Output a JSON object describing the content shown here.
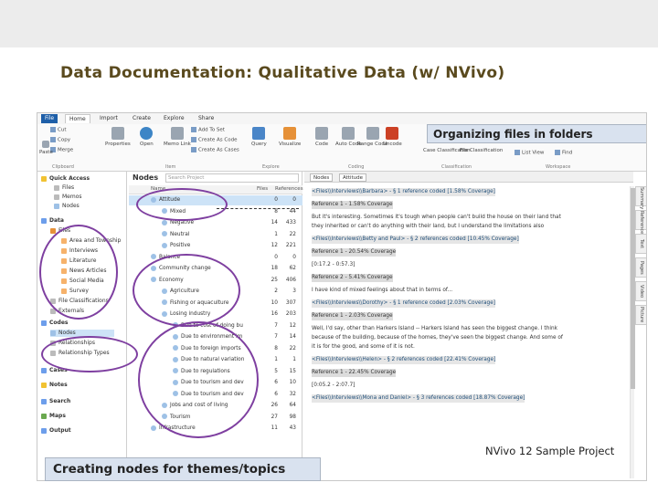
{
  "slide": {
    "title": "Data Documentation: Qualitative Data (w/ NVivo)",
    "callout_folders": "Organizing files in folders",
    "callout_nodes": "Creating nodes for themes/topics",
    "sample_project": "NVivo 12 Sample Project"
  },
  "ribbon": {
    "tabs": [
      "File",
      "Home",
      "Import",
      "Create",
      "Explore",
      "Share"
    ],
    "buttons": [
      "Cut",
      "Copy",
      "Merge",
      "Paste",
      "Properties",
      "Open",
      "Memo Link",
      "Add To Set",
      "Create As Code",
      "Create As Cases",
      "Query",
      "Visualize",
      "Code",
      "Auto Code",
      "Range Code",
      "Uncode",
      "Case Classification",
      "File Classification",
      "List View",
      "Find"
    ],
    "groups": [
      "Clipboard",
      "Item",
      "Explore",
      "Coding",
      "Classification",
      "Workspace"
    ]
  },
  "nav": {
    "items": [
      "Quick Access",
      "Files",
      "Memos",
      "Nodes",
      "Data",
      "Files",
      "Area and Township",
      "Interviews",
      "Literature",
      "News Articles",
      "Social Media",
      "Survey",
      "File Classifications",
      "Externals",
      "Codes",
      "Nodes",
      "Relationships",
      "Relationship Types",
      "Cases",
      "Notes",
      "Search",
      "Maps",
      "Output"
    ]
  },
  "nodes_pane": {
    "title": "Nodes",
    "search_placeholder": "Search Project",
    "col_name": "Name",
    "col_files": "Files",
    "col_refs": "References",
    "rows": [
      {
        "name": "Attitude",
        "files": "0",
        "refs": "0"
      },
      {
        "name": "Mixed",
        "files": "8",
        "refs": "44"
      },
      {
        "name": "Negative",
        "files": "14",
        "refs": "433"
      },
      {
        "name": "Neutral",
        "files": "1",
        "refs": "22"
      },
      {
        "name": "Positive",
        "files": "12",
        "refs": "221"
      },
      {
        "name": "Balance",
        "files": "0",
        "refs": "0"
      },
      {
        "name": "Community change",
        "files": "18",
        "refs": "62"
      },
      {
        "name": "Economy",
        "files": "25",
        "refs": "406"
      },
      {
        "name": "Agriculture",
        "files": "2",
        "refs": "3"
      },
      {
        "name": "Fishing or aquaculture",
        "files": "10",
        "refs": "307"
      },
      {
        "name": "Losing industry",
        "files": "16",
        "refs": "203"
      },
      {
        "name": "Due to cost of doing bu",
        "files": "7",
        "refs": "12"
      },
      {
        "name": "Due to environment im",
        "files": "7",
        "refs": "14"
      },
      {
        "name": "Due to foreign imports",
        "files": "8",
        "refs": "22"
      },
      {
        "name": "Due to natural variation",
        "files": "1",
        "refs": "1"
      },
      {
        "name": "Due to regulations",
        "files": "5",
        "refs": "15"
      },
      {
        "name": "Due to tourism and dev",
        "files": "6",
        "refs": "10"
      },
      {
        "name": "Due to tourism and dev",
        "files": "6",
        "refs": "32"
      },
      {
        "name": "Jobs and cost of living",
        "files": "26",
        "refs": "64"
      },
      {
        "name": "Tourism",
        "files": "27",
        "refs": "98"
      },
      {
        "name": "Infrastructure",
        "files": "11",
        "refs": "43"
      }
    ]
  },
  "ref_pane": {
    "tabs": [
      "Nodes",
      "Attitude"
    ],
    "lines": [
      "<Files\\\\Interviews\\\\Barbara> - § 1 reference coded [1.58% Coverage]",
      "Reference 1 - 1.58% Coverage",
      "But it's interesting. Sometimes it's tough when people can't build the house on their land that",
      "they inherited or can't do anything with their land, but I understand the limitations also",
      "<Files\\\\Interviews\\\\Betty and Paul> - § 2 references coded [10.45% Coverage]",
      "Reference 1 - 20.54% Coverage",
      "[0:17.2 - 0:57.3]",
      "Reference 2 - 5.41% Coverage",
      "I have kind of mixed feelings about that in terms of...",
      "<Files\\\\Interviews\\\\Dorothy> - § 1 reference coded [2.03% Coverage]",
      "Reference 1 - 2.03% Coverage",
      "Well, I'd say, other than Harkers Island -- Harkers Island has seen the biggest change. I think",
      "because of the building, because of the homes, they've seen the biggest change. And some of",
      "it is for the good, and some of it is not.",
      "<Files\\\\Interviews\\\\Helen> - § 2 references coded [22.41% Coverage]",
      "Reference 1 - 22.45% Coverage",
      "[0:05.2 - 2:07.7]",
      "<Files\\\\Interviews\\\\Mona and Daniel> - § 3 references coded [18.87% Coverage]"
    ],
    "side_tabs": [
      "Summary",
      "Reference",
      "Text",
      "Pages",
      "Video",
      "Picture"
    ]
  }
}
